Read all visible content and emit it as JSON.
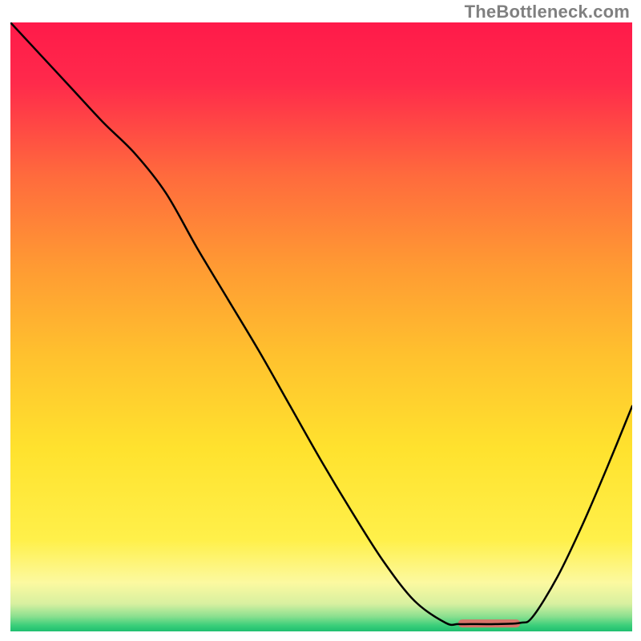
{
  "attribution": "TheBottleneck.com",
  "chart_data": {
    "type": "line",
    "title": "",
    "xlabel": "",
    "ylabel": "",
    "xlim": [
      0,
      100
    ],
    "ylim": [
      0,
      100
    ],
    "x": [
      0,
      5,
      10,
      15,
      20,
      25,
      30,
      35,
      40,
      45,
      50,
      55,
      60,
      65,
      70,
      72,
      74,
      78,
      82,
      84,
      88,
      92,
      96,
      100
    ],
    "y": [
      100,
      94.5,
      89,
      83.5,
      78.5,
      72,
      63,
      54.5,
      46,
      37,
      28,
      19.5,
      11.5,
      5,
      1.4,
      1.2,
      1.2,
      1.2,
      1.4,
      2.4,
      9,
      17.5,
      27,
      37
    ],
    "indicator": {
      "type": "bar",
      "x_center": 77,
      "x_half_width": 5,
      "y": 1.3,
      "color": "#d9746b",
      "thickness": 10
    },
    "gradient_stops": [
      {
        "pos": 0.0,
        "color": "#ff1a4a"
      },
      {
        "pos": 0.1,
        "color": "#ff2a4b"
      },
      {
        "pos": 0.25,
        "color": "#ff6a3d"
      },
      {
        "pos": 0.4,
        "color": "#ff9a33"
      },
      {
        "pos": 0.55,
        "color": "#ffc22e"
      },
      {
        "pos": 0.7,
        "color": "#ffe22e"
      },
      {
        "pos": 0.85,
        "color": "#fff04a"
      },
      {
        "pos": 0.92,
        "color": "#fcf9a0"
      },
      {
        "pos": 0.955,
        "color": "#d7f0a0"
      },
      {
        "pos": 0.975,
        "color": "#8de090"
      },
      {
        "pos": 0.99,
        "color": "#3ccf7a"
      },
      {
        "pos": 1.0,
        "color": "#1fbf70"
      }
    ]
  }
}
